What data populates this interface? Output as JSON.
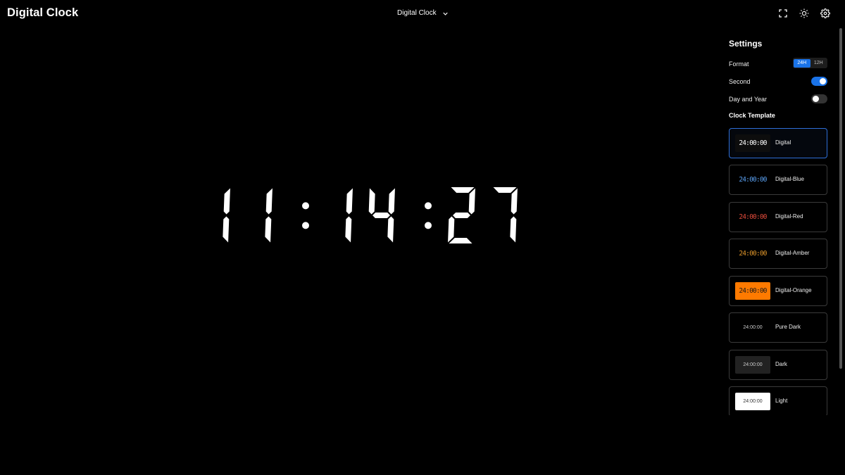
{
  "header": {
    "app_title": "Digital Clock",
    "clock_selector": "Digital Clock",
    "icons": [
      "fullscreen-icon",
      "sun-icon",
      "gear-icon"
    ]
  },
  "clock": {
    "time": "11:14:27",
    "color": "#ffffff",
    "background": "#000000"
  },
  "settings": {
    "title": "Settings",
    "format_label": "Format",
    "format_options": [
      "24H",
      "12H"
    ],
    "format_selected": "24H",
    "second_label": "Second",
    "second_on": true,
    "day_year_label": "Day and Year",
    "day_year_on": false,
    "template_title": "Clock Template",
    "templates": [
      {
        "name": "Digital",
        "preview": "24:00:00",
        "color": "#ffffff",
        "bg": "#0d0d0d",
        "selected": true
      },
      {
        "name": "Digital-Blue",
        "preview": "24:00:00",
        "color": "#5aa0f0",
        "bg": "#000000"
      },
      {
        "name": "Digital-Red",
        "preview": "24:00:00",
        "color": "#e04a3a",
        "bg": "#000000"
      },
      {
        "name": "Digital-Amber",
        "preview": "24:00:00",
        "color": "#e0962a",
        "bg": "#000000"
      },
      {
        "name": "Digital-Orange",
        "preview": "24:00:00",
        "color": "#1a1a1a",
        "bg": "#ff7a00"
      },
      {
        "name": "Pure Dark",
        "preview": "24:00:00",
        "color": "#cccccc",
        "bg": "#000000"
      },
      {
        "name": "Dark",
        "preview": "24:00:00",
        "color": "#cccccc",
        "bg": "#222222"
      },
      {
        "name": "Light",
        "preview": "24:00:00",
        "color": "#333333",
        "bg": "#ffffff"
      }
    ]
  },
  "colors": {
    "accent": "#1a73e8",
    "selected_border": "#2e6fd8"
  }
}
